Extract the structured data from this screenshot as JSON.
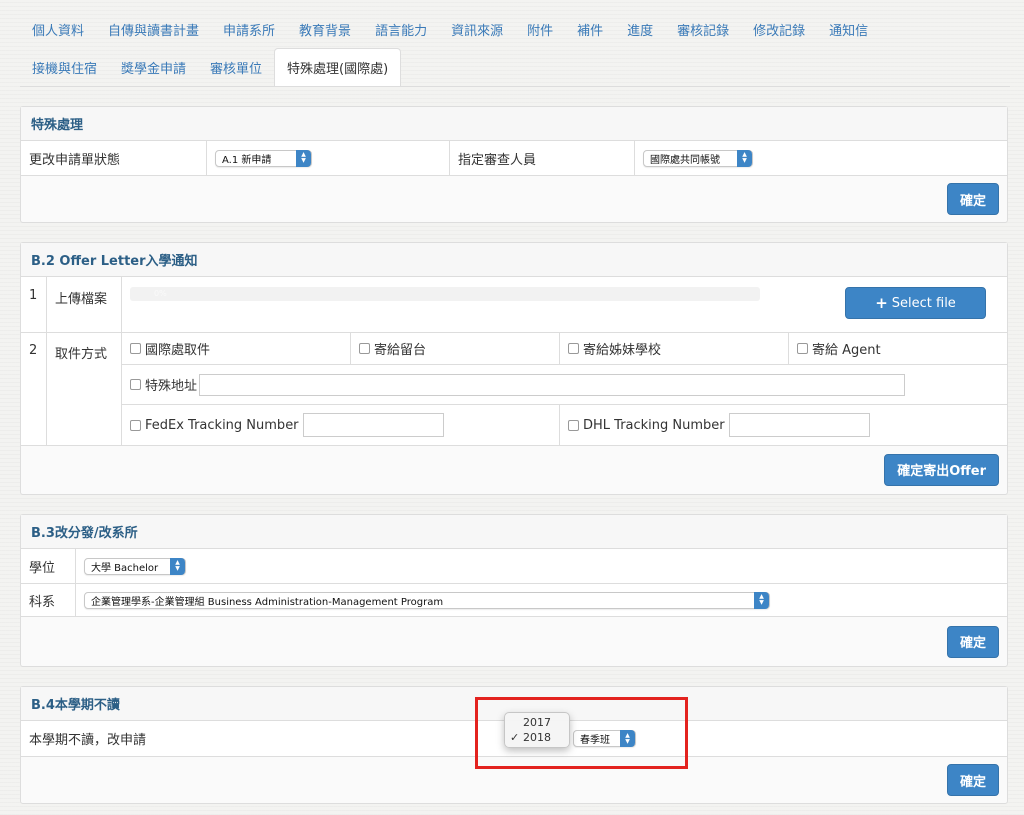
{
  "tabs": {
    "row1": [
      "個人資料",
      "自傳與讀書計畫",
      "申請系所",
      "教育背景",
      "語言能力",
      "資訊來源",
      "附件",
      "補件",
      "進度",
      "審核記錄",
      "修改記錄",
      "通知信"
    ],
    "row2": [
      "接機與住宿",
      "獎學金申請",
      "審核單位",
      "特殊處理(國際處)"
    ],
    "active": "特殊處理(國際處)"
  },
  "special": {
    "title": "特殊處理",
    "status_label": "更改申請單狀態",
    "status_value": "A.1 新申請",
    "reviewer_label": "指定審查人員",
    "reviewer_value": "國際處共同帳號",
    "confirm_label": "確定"
  },
  "offer": {
    "title": "B.2 Offer Letter入學通知",
    "row1_no": "1",
    "upload_label": "上傳檔案",
    "progress_text": "0%",
    "select_file_label": "Select file",
    "row2_no": "2",
    "pickup_label": "取件方式",
    "opt_intl": "國際處取件",
    "opt_taiwan": "寄給留台",
    "opt_sister": "寄給姊妹學校",
    "opt_agent": "寄給 Agent",
    "opt_special": "特殊地址",
    "fedex_label": "FedEx Tracking Number",
    "dhl_label": "DHL Tracking Number",
    "send_label": "確定寄出Offer"
  },
  "transfer": {
    "title": "B.3改分發/改系所",
    "degree_label": "學位",
    "degree_value": "大學 Bachelor",
    "dept_label": "科系",
    "dept_value": "企業管理學系-企業管理組 Business Administration-Management Program",
    "confirm_label": "確定"
  },
  "defer": {
    "title": "B.4本學期不讀",
    "label": "本學期不讀，改申請",
    "term_value": "春季班",
    "confirm_label": "確定",
    "year_options": [
      "2017",
      "2018"
    ],
    "year_selected": "2018"
  },
  "colors": {
    "link": "#3a7ab8",
    "button": "#3d85c6",
    "heading": "#2c5f86",
    "highlight": "#e3231f"
  }
}
